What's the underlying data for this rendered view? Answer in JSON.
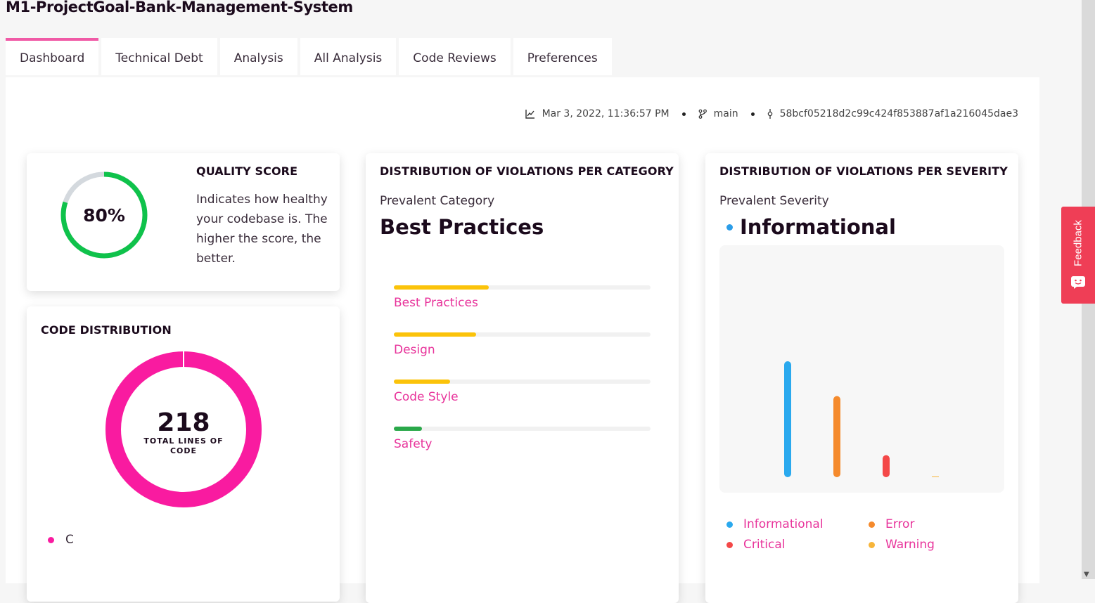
{
  "project": {
    "title": "M1-ProjectGoal-Bank-Management-System"
  },
  "tabs": [
    {
      "label": "Dashboard",
      "active": true
    },
    {
      "label": "Technical Debt"
    },
    {
      "label": "Analysis"
    },
    {
      "label": "All Analysis"
    },
    {
      "label": "Code Reviews"
    },
    {
      "label": "Preferences"
    }
  ],
  "meta": {
    "date": "Mar 3, 2022, 11:36:57 PM",
    "branch": "main",
    "commit": "58bcf05218d2c99c424f853887af1a216045dae3"
  },
  "quality": {
    "title": "QUALITY SCORE",
    "score_label": "80%",
    "score_fraction": 0.8,
    "description": "Indicates how healthy your codebase is. The higher the score, the better.",
    "color": "#0fc24b",
    "track_color": "#d4d9de"
  },
  "code_distribution": {
    "title": "CODE DISTRIBUTION",
    "total": "218",
    "total_label": "TOTAL LINES OF CODE",
    "legend": [
      {
        "label": "C",
        "color": "#f91ba0"
      }
    ]
  },
  "category": {
    "title": "DISTRIBUTION OF VIOLATIONS PER CATEGORY",
    "prevalent_label": "Prevalent Category",
    "prevalent_value": "Best Practices",
    "bars": [
      {
        "label": "Best Practices",
        "fraction": 0.37,
        "color": "#fbc30a"
      },
      {
        "label": "Design",
        "fraction": 0.32,
        "color": "#fbc30a"
      },
      {
        "label": "Code Style",
        "fraction": 0.22,
        "color": "#fbc30a"
      },
      {
        "label": "Safety",
        "fraction": 0.11,
        "color": "#2aa84a"
      }
    ]
  },
  "severity": {
    "title": "DISTRIBUTION OF VIOLATIONS PER SEVERITY",
    "prevalent_label": "Prevalent Severity",
    "prevalent_value": "Informational",
    "prevalent_color": "#2b9de8",
    "chart_data": {
      "type": "bar",
      "categories": [
        "Informational",
        "Error",
        "Critical",
        "Warning"
      ],
      "values": [
        100,
        70,
        19,
        0.5
      ],
      "colors": [
        "#2aa9ee",
        "#f58a2c",
        "#f44848",
        "#f7b53b"
      ],
      "ylim": [
        0,
        100
      ]
    },
    "legend": [
      {
        "label": "Informational",
        "color": "#2aa9ee"
      },
      {
        "label": "Error",
        "color": "#f58a2c"
      },
      {
        "label": "Critical",
        "color": "#f44848"
      },
      {
        "label": "Warning",
        "color": "#f7b53b"
      }
    ]
  },
  "feedback": {
    "label": "Feedback"
  }
}
